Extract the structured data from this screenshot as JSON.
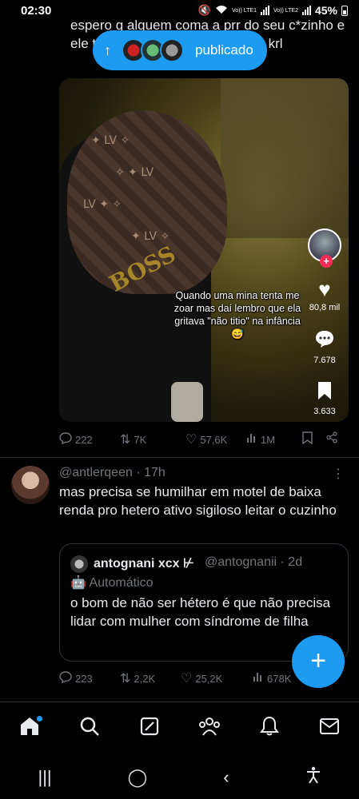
{
  "status_bar": {
    "time": "02:30",
    "network_1": "Vo)) LTE1",
    "network_2": "Vo)) LTE2",
    "battery": "45%"
  },
  "top_tweet": {
    "text": "espero q alguem coma a prr do seu c*zinho e ele te deixe no vacuo e tu m0rr4 krl",
    "video": {
      "overlay_text": "BOSS",
      "caption": "Quando uma mina tenta me zoar mas daí lembro que ela gritava \"não titio\" na infância😅",
      "likes": "80,8 mil",
      "comments": "7.678",
      "saves": "3.633"
    },
    "actions": {
      "replies": "222",
      "reposts": "7K",
      "likes": "57,6K",
      "views": "1M"
    }
  },
  "posted_toast": {
    "label": "publicado",
    "arrow": "↑"
  },
  "second_tweet": {
    "handle": "@antlerqeen",
    "time": "· 17h",
    "text": "mas precisa se humilhar em motel de baixa renda pro hetero ativo sigiloso leitar o cuzinho",
    "quote": {
      "name": "antognani xcx",
      "name_suffix": "⊬",
      "handle": "@antognanii · 2d",
      "automated": "Automático",
      "text": "o bom de não ser hétero é que não precisa lidar com mulher com síndrome de filha"
    },
    "actions": {
      "replies": "223",
      "reposts": "2,2K",
      "likes": "25,2K",
      "views": "678K"
    }
  },
  "fab": {
    "label": "+"
  },
  "bottom_nav": [
    "home-icon",
    "search-icon",
    "grok-icon",
    "communities-icon",
    "notifications-icon",
    "messages-icon"
  ],
  "system_nav": {
    "recents": "|||",
    "home": "◯",
    "back": "‹"
  },
  "colors": {
    "accent": "#1d9bf0",
    "muted": "#71767b",
    "background": "#000000"
  }
}
